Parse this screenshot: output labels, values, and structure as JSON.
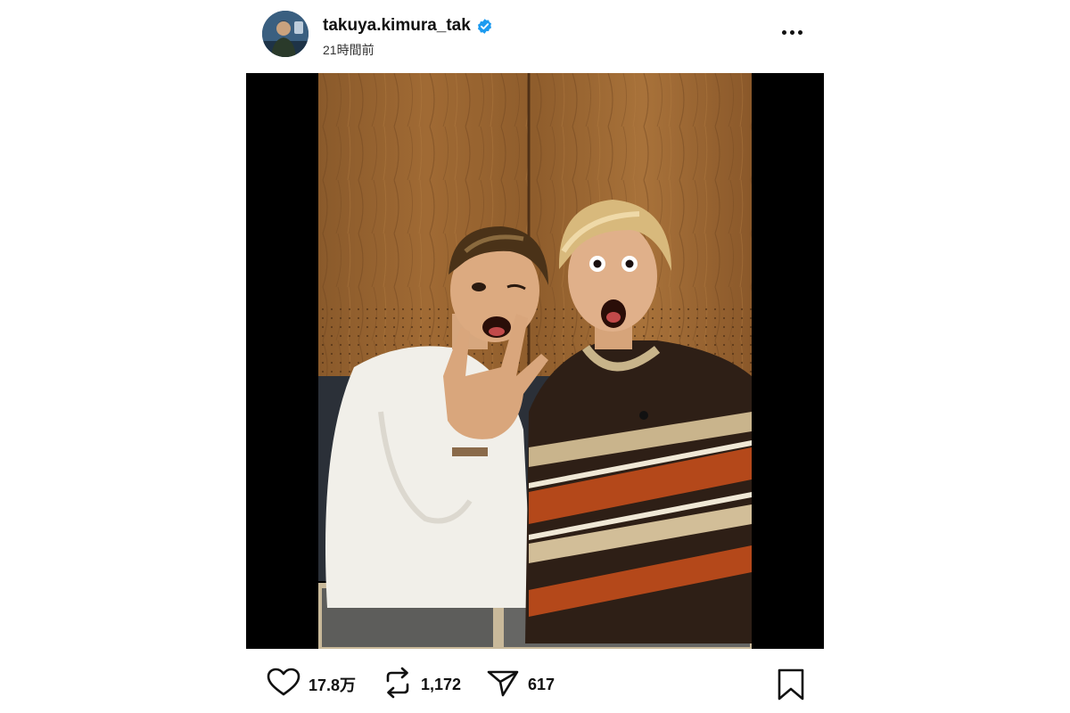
{
  "post": {
    "username": "takuya.kimura_tak",
    "verified": true,
    "timestamp": "21時間前",
    "avatar_icon": "user-avatar",
    "more_icon": "more-horizontal-icon"
  },
  "actions": {
    "like_icon": "heart-icon",
    "like_count": "17.8万",
    "repost_icon": "repost-icon",
    "repost_count": "1,172",
    "share_icon": "send-icon",
    "share_count": "617",
    "save_icon": "bookmark-icon"
  },
  "colors": {
    "verified_blue": "#1d9bf0",
    "media_background": "#000000",
    "text": "#111111"
  }
}
